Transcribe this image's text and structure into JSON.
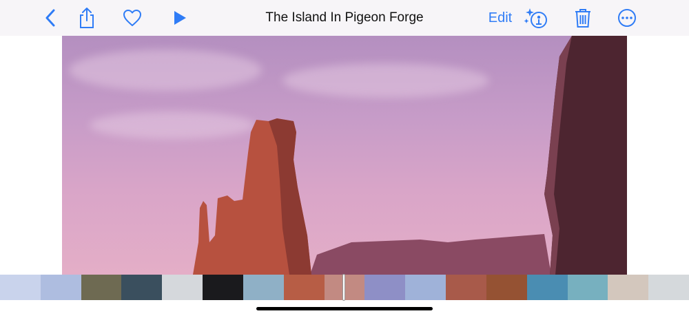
{
  "toolbar": {
    "title": "The Island In Pigeon Forge",
    "edit_label": "Edit",
    "icons": [
      "chevron-left-icon",
      "share-icon",
      "heart-icon",
      "play-icon",
      "visual-look-up-icon",
      "trash-icon",
      "more-icon"
    ],
    "accent_color": "#2f7cf6"
  },
  "filmstrip": {
    "thumbnail_colors": [
      "#c9d3ec",
      "#aebde0",
      "#6e6a52",
      "#3a4f5e",
      "#d5d8dc",
      "#1a1a1d",
      "#8fb0c6",
      "#b75d45",
      "#c28a82",
      "#8e8fc6",
      "#9fb2d9",
      "#a85a4a",
      "#955233",
      "#4a8db2",
      "#77b0bf",
      "#d3c7bd",
      "#d5d9dc"
    ]
  }
}
